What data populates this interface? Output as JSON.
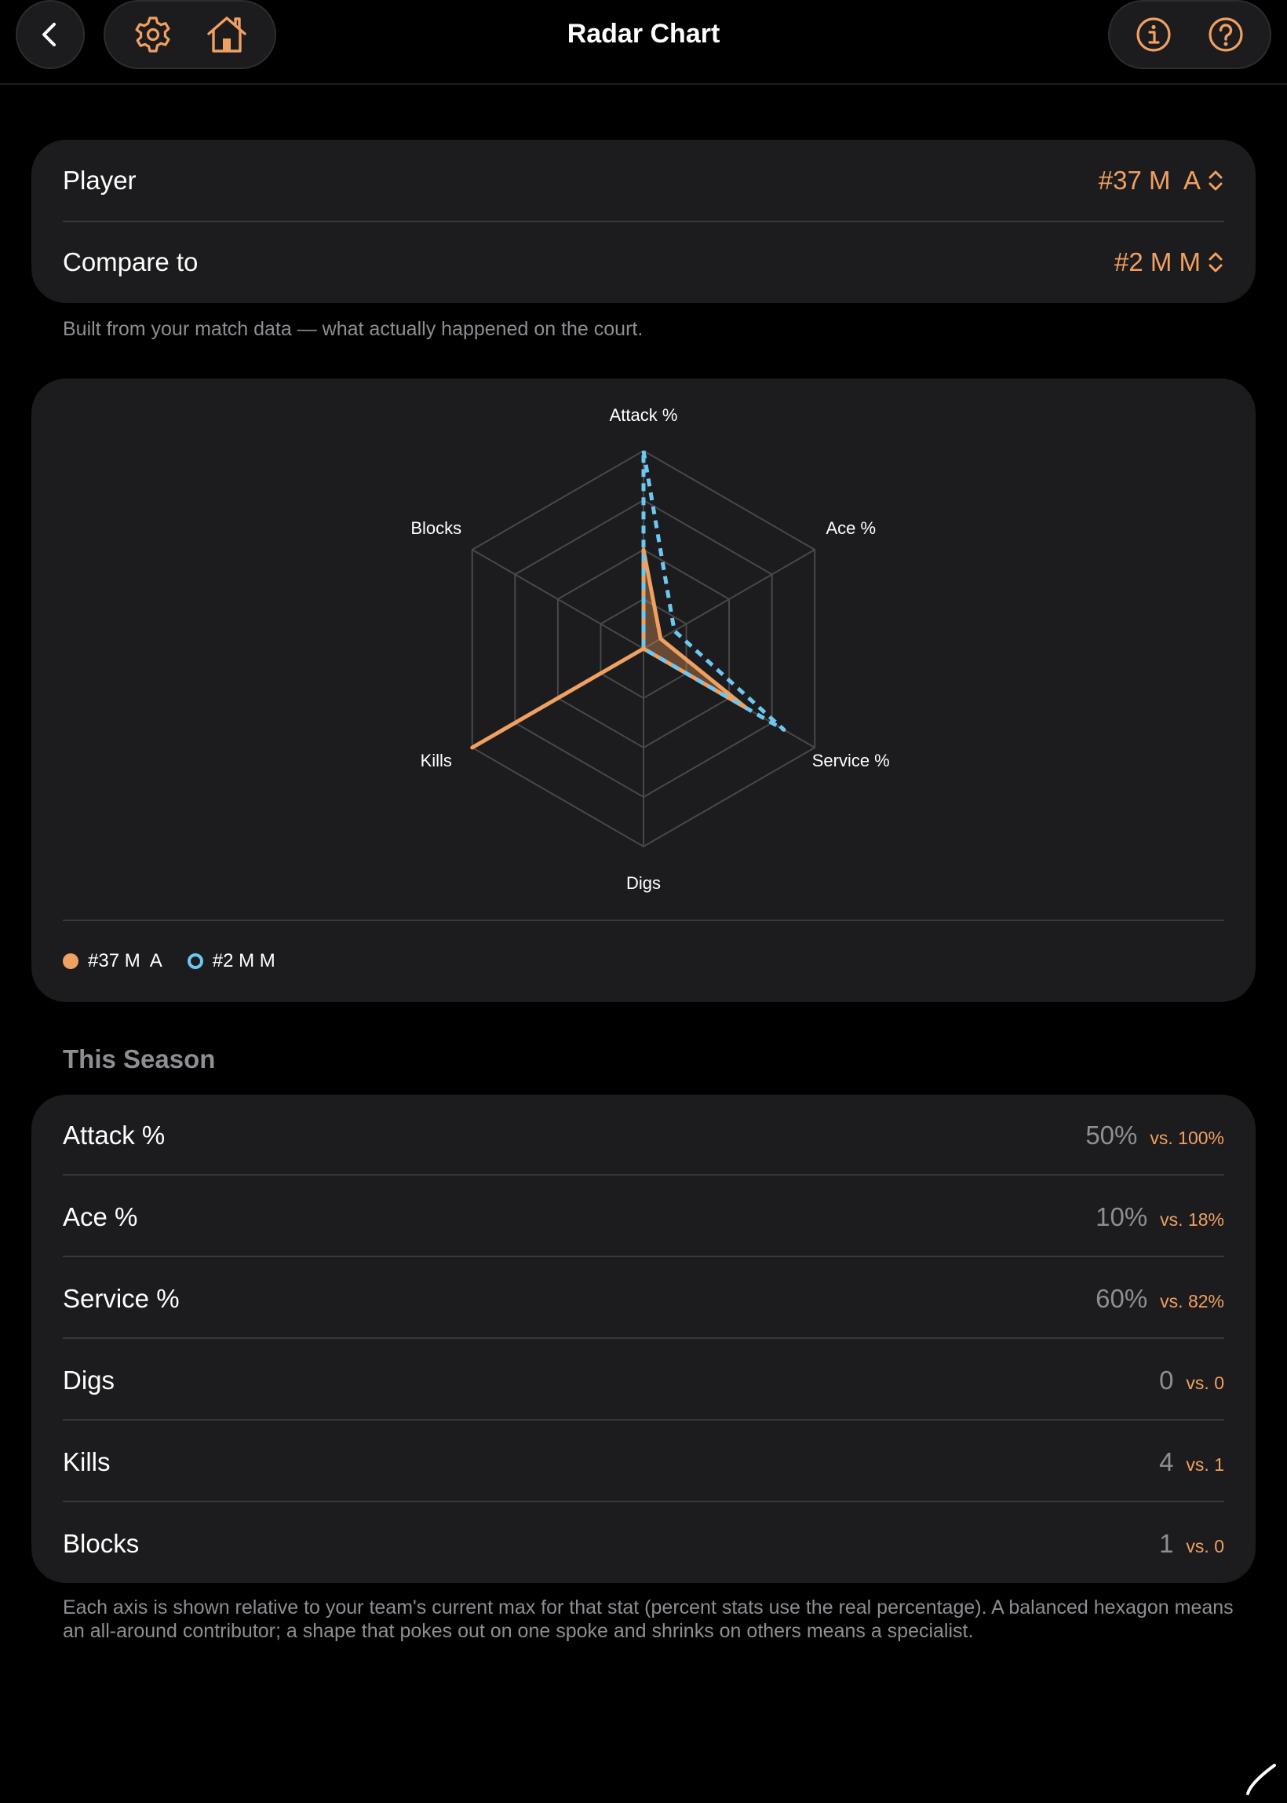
{
  "header": {
    "title": "Radar Chart"
  },
  "player_picker": {
    "label": "Player",
    "value": "#37 M  A"
  },
  "compare_picker": {
    "label": "Compare to",
    "value": "#2 M M"
  },
  "picker_caption": "Built from your match data — what actually happened on the court.",
  "chart_data": {
    "type": "radar",
    "axes": [
      "Attack %",
      "Ace %",
      "Service %",
      "Digs",
      "Kills",
      "Blocks"
    ],
    "rings": 4,
    "series": [
      {
        "name": "#37 M  A",
        "color": "#f0a060",
        "style": "solid-filled",
        "values": [
          0.5,
          0.1,
          0.6,
          0.0,
          1.0,
          0.0
        ]
      },
      {
        "name": "#2 M M",
        "color": "#6cc8f0",
        "style": "dashed",
        "values": [
          1.0,
          0.18,
          0.82,
          0.0,
          0.0,
          0.0
        ]
      }
    ]
  },
  "season": {
    "title": "This Season",
    "rows": [
      {
        "label": "Attack %",
        "value": "50%",
        "vs": "vs. 100%"
      },
      {
        "label": "Ace %",
        "value": "10%",
        "vs": "vs. 18%"
      },
      {
        "label": "Service %",
        "value": "60%",
        "vs": "vs. 82%"
      },
      {
        "label": "Digs",
        "value": "0",
        "vs": "vs. 0"
      },
      {
        "label": "Kills",
        "value": "4",
        "vs": "vs. 1"
      },
      {
        "label": "Blocks",
        "value": "1",
        "vs": "vs. 0"
      }
    ]
  },
  "footer_caption": "Each axis is shown relative to your team's current max for that stat (percent stats use the real percentage). A balanced hexagon means an all-around contributor; a shape that pokes out on one spoke and shrinks on others means a specialist.",
  "colors": {
    "accent": "#f0a060",
    "compare": "#6cc8f0",
    "card": "#1c1c1e",
    "background": "#000000"
  },
  "icons": {
    "back": "chevron-left-icon",
    "settings": "gear-icon",
    "home": "home-icon",
    "info": "info-icon",
    "help": "question-icon"
  }
}
